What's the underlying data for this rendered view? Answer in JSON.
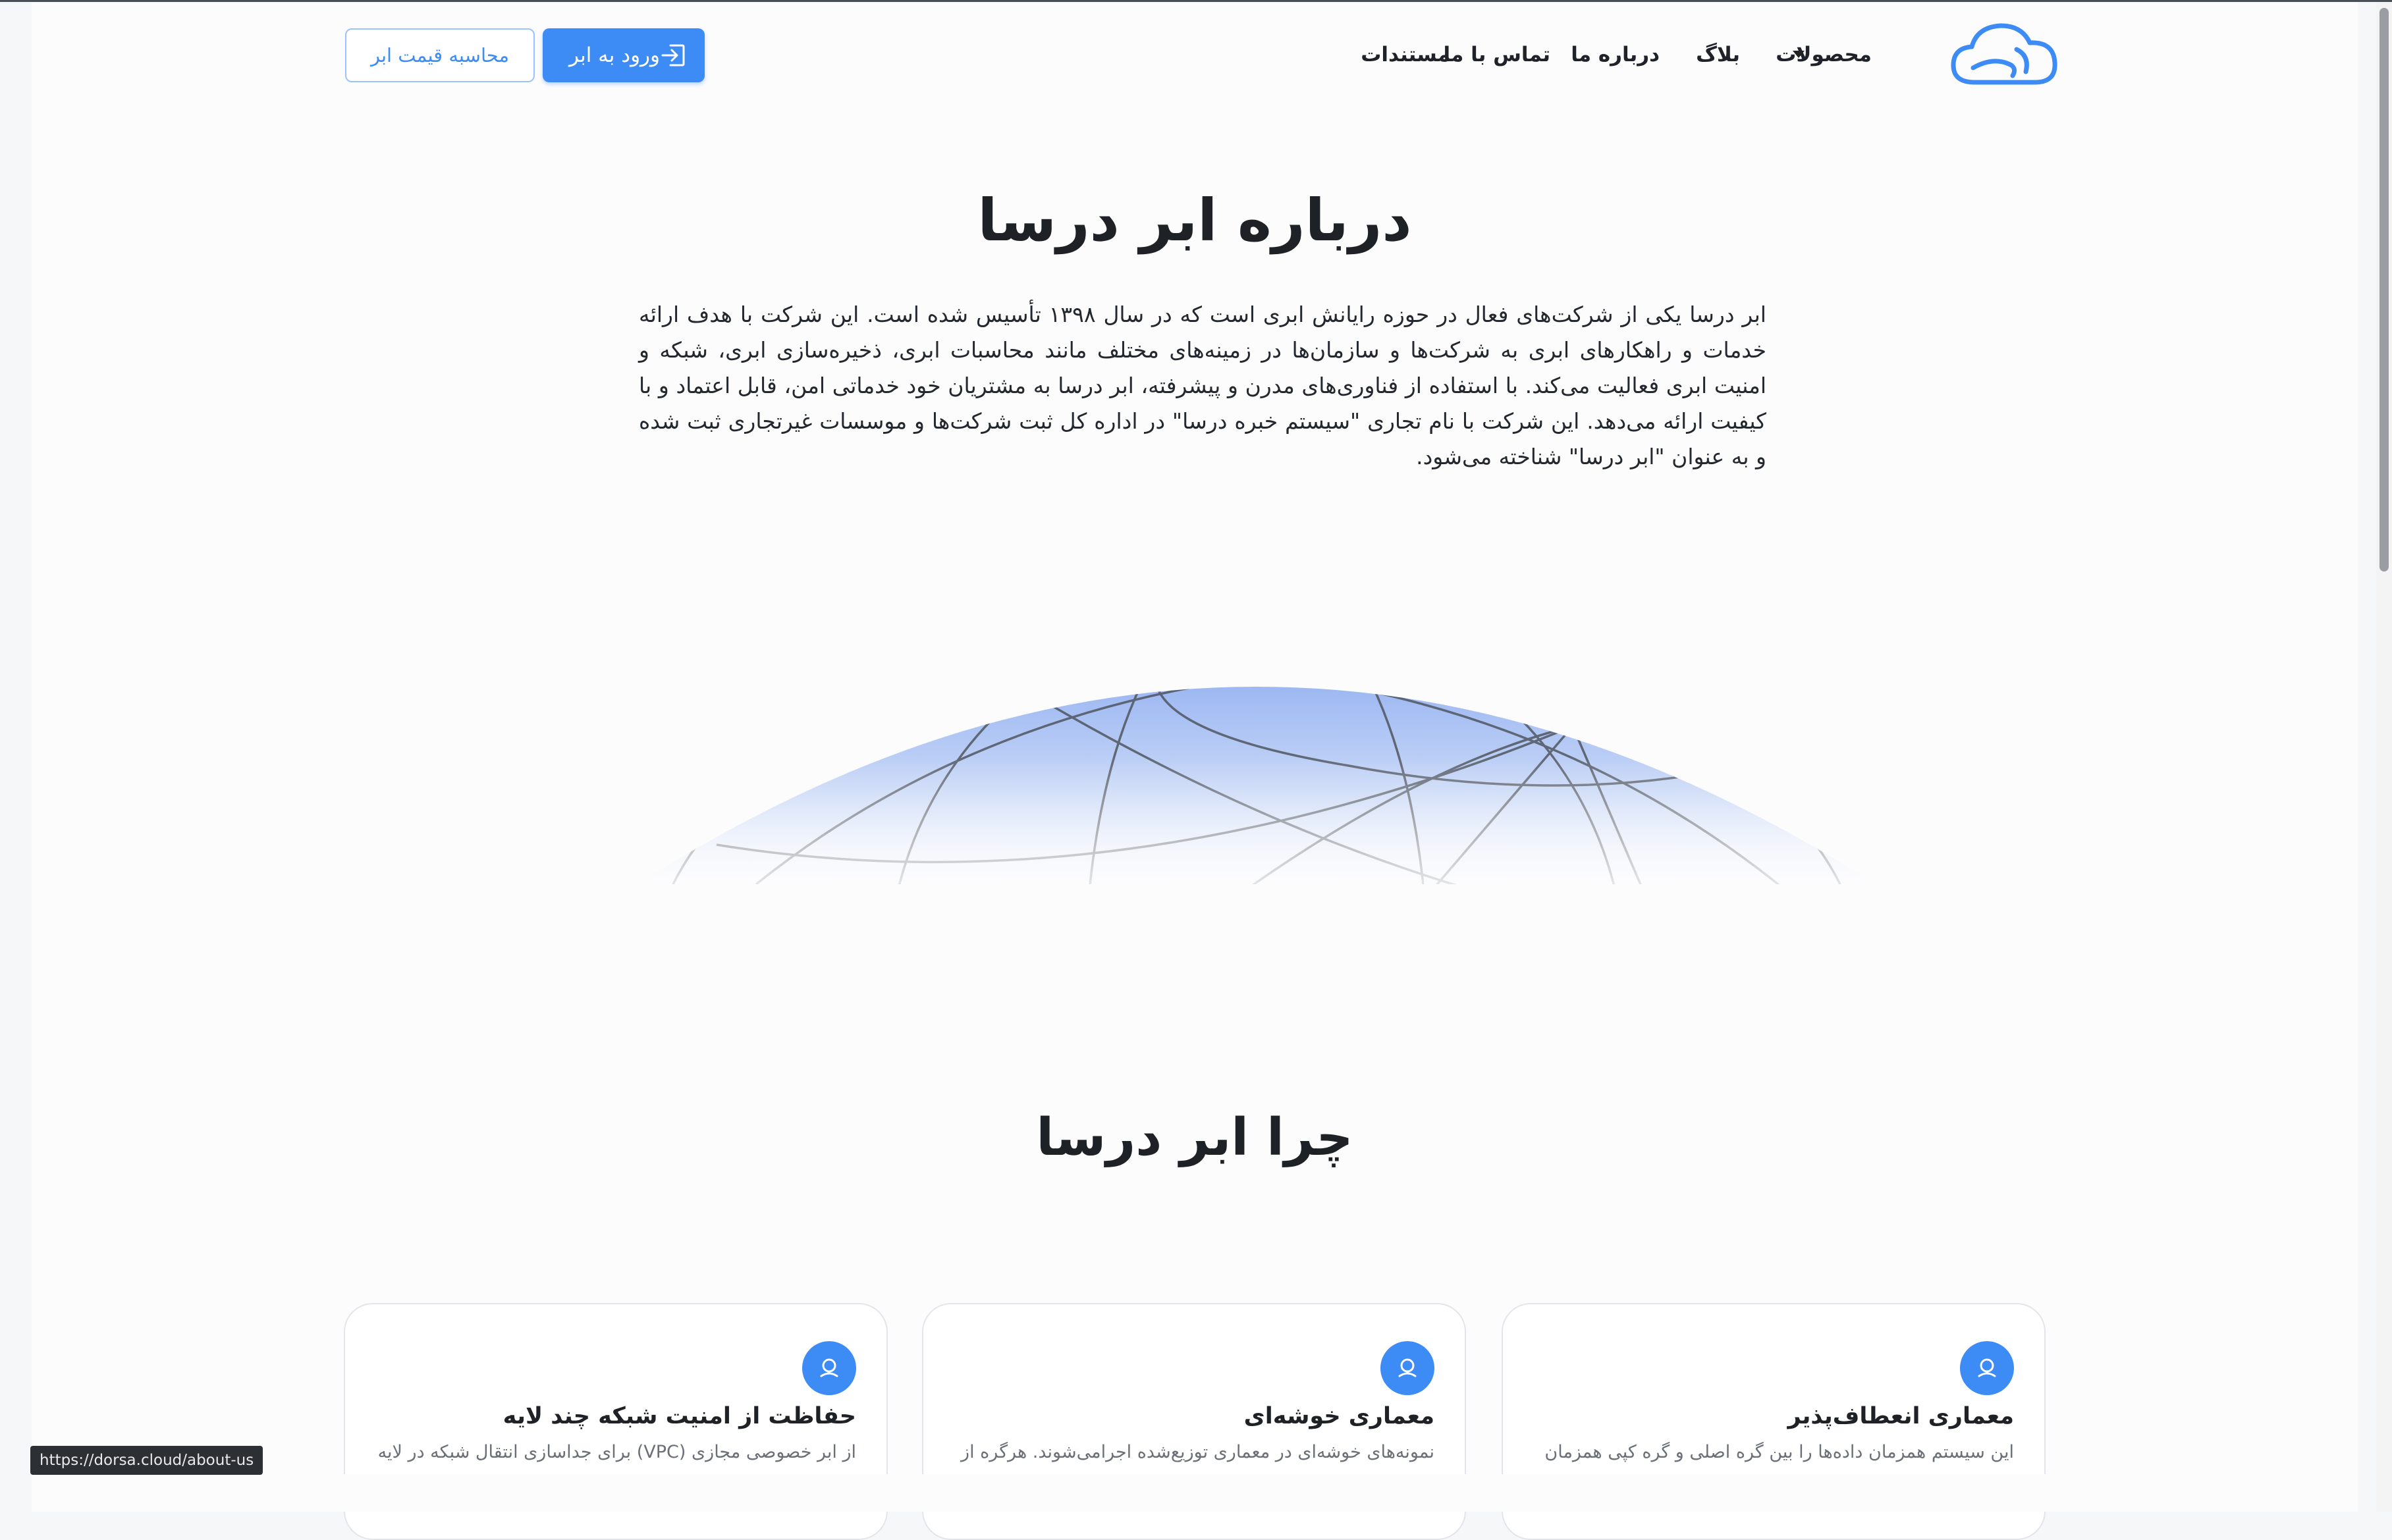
{
  "header": {
    "nav": {
      "products": "محصولات",
      "blog": "بلاگ",
      "about": "درباره ما",
      "contact": "تماس با ما",
      "docs": "مستندات"
    },
    "login_button": "ورود به ابر",
    "price_button": "محاسبه قیمت ابر",
    "logo_icon": "cloud-logo-icon",
    "accent_color": "#3d8cf5"
  },
  "hero": {
    "title": "درباره ابر درسا",
    "paragraph": "ابر درسا یکی از شرکت‌های فعال در حوزه رایانش ابری است که در سال ۱۳۹۸ تأسیس شده است. این شرکت با هدف ارائه خدمات و راهکارهای ابری به شرکت‌ها و سازمان‌ها در زمینه‌های مختلف مانند محاسبات ابری، ذخیره‌سازی ابری، شبکه و امنیت ابری فعالیت می‌کند. با استفاده از فناوری‌های مدرن و پیشرفته، ابر درسا به مشتریان خود خدماتی امن، قابل اعتماد و با کیفیت ارائه می‌دهد. این شرکت با نام تجاری \"سیستم خبره درسا\" در اداره کل ثبت شرکت‌ها و موسسات غیرتجاری ثبت شده و به عنوان \"ابر درسا\" شناخته می‌شود."
  },
  "why": {
    "title": "چرا ابر درسا",
    "cards": [
      {
        "title": "معماری انعطاف‌پذیر",
        "desc": "این سیستم همزمان داده‌ها را بین گره اصلی و گره کپی همزمان",
        "icon": "support-icon"
      },
      {
        "title": "معماری خوشه‌ای",
        "desc": "نمونه‌های خوشه‌ای در معماری توزیع‌شده اجرامی‌شوند. هرگره از",
        "icon": "support-icon"
      },
      {
        "title": "حفاظت از امنیت شبکه چند لایه",
        "desc": "از ابر خصوصی مجازی (VPC) برای جداسازی انتقال شبکه در لایه",
        "icon": "support-icon"
      }
    ]
  },
  "status_bar": {
    "url": "https://dorsa.cloud/about-us"
  }
}
